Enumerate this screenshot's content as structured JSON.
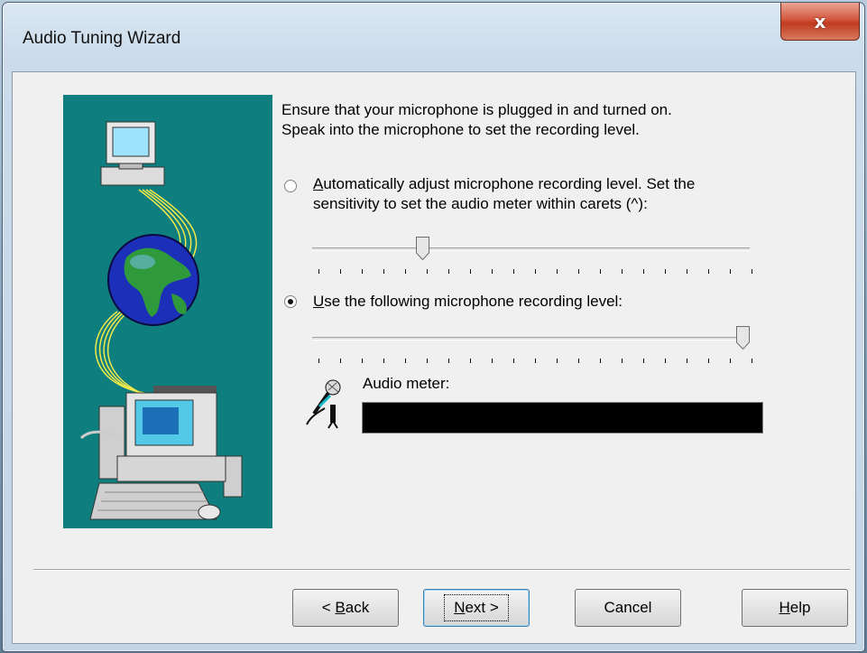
{
  "window": {
    "title": "Audio Tuning Wizard",
    "close_glyph": "x"
  },
  "instructions": {
    "line1": "Ensure that your microphone is plugged in and turned on.",
    "line2": "Speak into the microphone to set the recording level."
  },
  "auto_option": {
    "selected": false,
    "label_accel": "A",
    "label_rest": "utomatically adjust microphone recording level. Set the",
    "label_line2": "sensitivity to set the audio meter within carets (^):",
    "slider_value": 0.25
  },
  "manual_option": {
    "selected": true,
    "label_accel": "U",
    "label_rest": "se the following microphone recording level:",
    "slider_value": 1.0
  },
  "audio_meter": {
    "label": "Audio meter:",
    "level": 0
  },
  "buttons": {
    "back": {
      "prefix": "< ",
      "accel": "B",
      "rest": "ack"
    },
    "next": {
      "accel": "N",
      "rest": "ext >"
    },
    "cancel": {
      "label": "Cancel"
    },
    "help": {
      "accel": "H",
      "rest": "elp"
    }
  },
  "colors": {
    "art_background": "#0f7e7e",
    "meter_background": "#000000",
    "close_button": "#c9452a"
  }
}
